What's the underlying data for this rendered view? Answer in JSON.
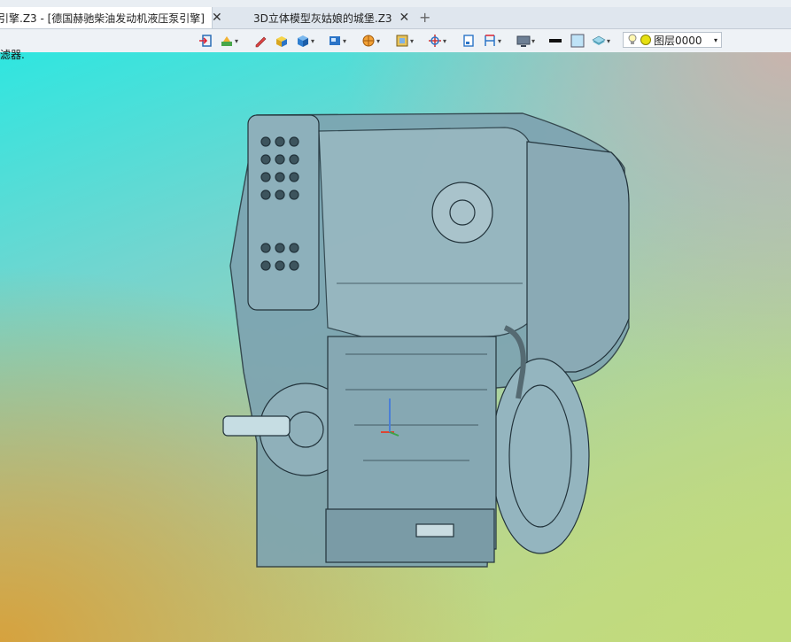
{
  "tabs": [
    {
      "label": "引擎.Z3 - [德国赫驰柴油发动机液压泵引擎]",
      "close": "✕"
    },
    {
      "label": "3D立体模型灰姑娘的城堡.Z3",
      "close": "✕"
    }
  ],
  "new_tab_symbol": "+",
  "layer": {
    "label": "图层0000"
  },
  "viewport": {
    "hint": "滤器."
  },
  "toolbar_icons": [
    "import-icon",
    "filter-icon",
    "pen-icon",
    "box-icon",
    "cube-icon",
    "view-icon",
    "shading-icon",
    "display-icon",
    "axis-icon",
    "frame-icon",
    "ruler-icon",
    "screen-icon",
    "color-swatch-icon",
    "light-swatch-icon",
    "layer-stack-icon",
    "bulb-icon"
  ],
  "colors": {
    "viewport_cyan": "#2fe6e0",
    "viewport_gold": "#d6a23e",
    "viewport_green": "#c1dc7c",
    "model_fill": "#7aa0ad"
  }
}
